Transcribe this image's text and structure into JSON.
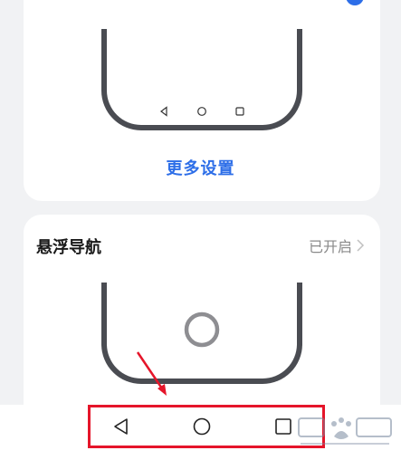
{
  "gesture_card": {
    "more_settings_label": "更多设置"
  },
  "float_nav_card": {
    "title": "悬浮导航",
    "status": "已开启"
  },
  "system_nav": {
    "buttons": [
      "back",
      "home",
      "recents"
    ]
  },
  "colors": {
    "accent": "#2d6ee8",
    "highlight": "#e5152a",
    "phone_frame": "#4a4c52"
  },
  "icons": {
    "back": "triangle-back-icon",
    "home": "circle-home-icon",
    "recents": "square-recents-icon",
    "chevron": "chevron-right-icon",
    "float_ball": "floating-ball-icon"
  }
}
